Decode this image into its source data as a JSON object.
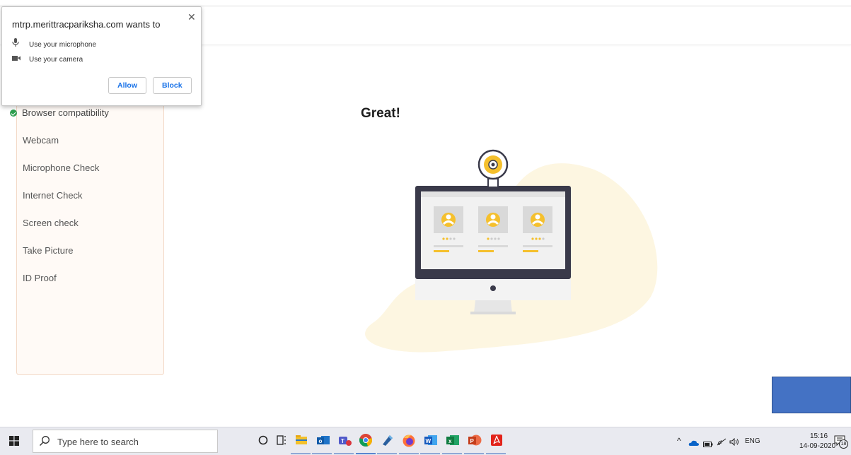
{
  "popup": {
    "title": "mtrp.merittracpariksha.com wants to",
    "close_glyph": "✕",
    "permissions": [
      {
        "label": "Use your microphone",
        "icon": "microphone-icon"
      },
      {
        "label": "Use your camera",
        "icon": "camera-icon"
      }
    ],
    "allow_label": "Allow",
    "block_label": "Block"
  },
  "sidebar": {
    "steps": [
      {
        "label": "Browser compatibility",
        "status": "done"
      },
      {
        "label": "Webcam",
        "status": "pending"
      },
      {
        "label": "Microphone Check",
        "status": "pending"
      },
      {
        "label": "Internet Check",
        "status": "pending"
      },
      {
        "label": "Screen check",
        "status": "pending"
      },
      {
        "label": "Take Picture",
        "status": "pending"
      },
      {
        "label": "ID Proof",
        "status": "pending"
      }
    ]
  },
  "main": {
    "heading": "Great!"
  },
  "colors": {
    "accent": "#f5c02d",
    "check_green": "#2e9e4f",
    "overlay_box": "#4472c4",
    "button_text": "#1a73e8"
  },
  "taskbar": {
    "search_placeholder": "Type here to search",
    "apps": [
      "cortana-icon",
      "task-view-icon",
      "file-explorer-icon",
      "outlook-icon",
      "teams-icon",
      "chrome-icon",
      "app-icon",
      "firefox-icon",
      "word-icon",
      "excel-icon",
      "powerpoint-icon",
      "acrobat-icon"
    ],
    "tray": {
      "language": "ENG",
      "time": "15:16",
      "date": "14-09-2020",
      "notification_count": "18"
    }
  }
}
